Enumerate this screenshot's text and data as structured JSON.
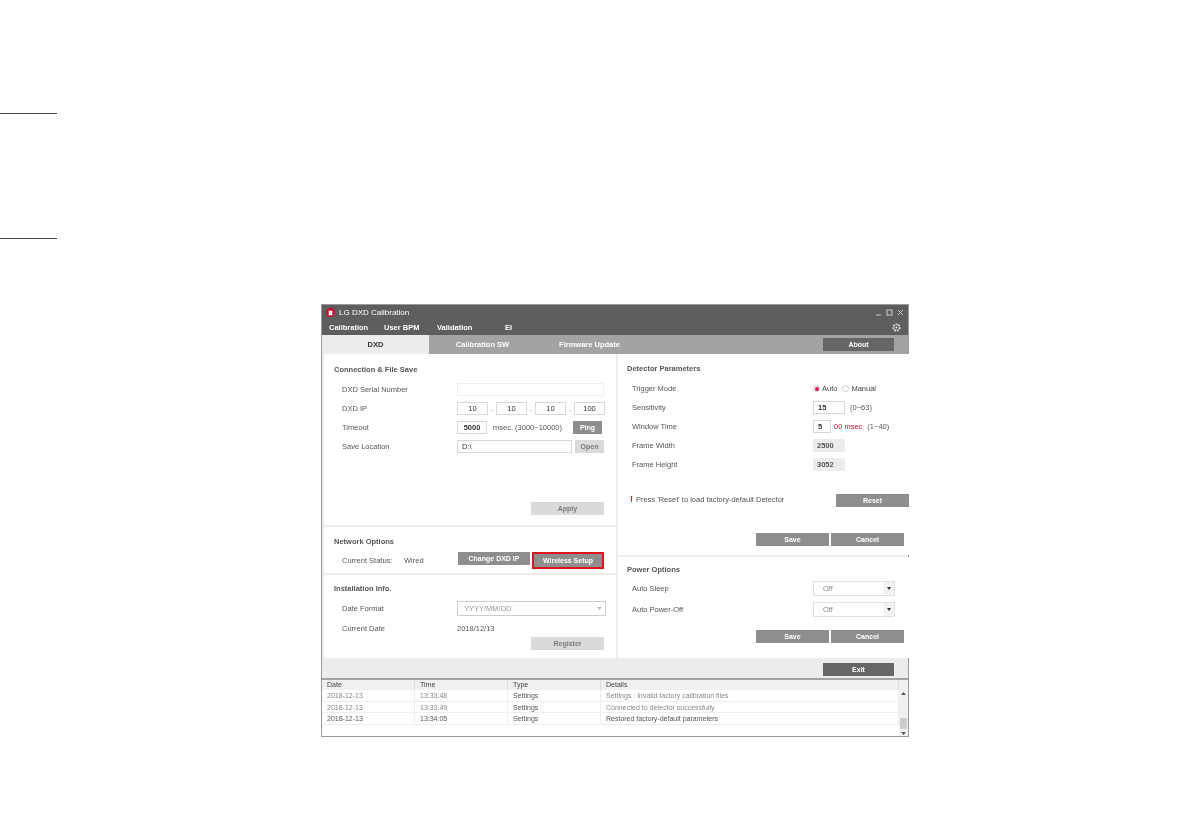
{
  "window": {
    "title": "LG DXD Calibration"
  },
  "menu": [
    "Calibration",
    "User BPM",
    "Validation",
    "EI"
  ],
  "tabs": [
    {
      "label": "DXD",
      "selected": true
    },
    {
      "label": "Calibration SW",
      "selected": false
    },
    {
      "label": "Firmware Update",
      "selected": false
    }
  ],
  "about_button": "About",
  "connection": {
    "title": "Connection & File Save",
    "serial_label": "DXD Serial Number",
    "ip_label": "DXD IP",
    "ip": [
      "10",
      "10",
      "10",
      "100"
    ],
    "ip_sep": ".",
    "timeout_label": "Timeout",
    "timeout": "5000",
    "timeout_hint": "msec. (3000~10000)",
    "ping": {
      "label": "Ping",
      "disabled": false
    },
    "save_label": "Save Location",
    "save_value": "D:\\",
    "open": {
      "label": "Open",
      "disabled": true
    },
    "apply": {
      "label": "Apply",
      "disabled": true
    }
  },
  "network": {
    "title": "Network Options",
    "status_label": "Current Status:",
    "status": "Wired",
    "buttons": [
      {
        "label": "Change DXD IP",
        "highlighted": false
      },
      {
        "label": "Wireless Setup",
        "highlighted": true
      }
    ]
  },
  "installation": {
    "title": "Installation Info.",
    "date_format_label": "Date Format",
    "date_format": "YYYY/MM/DD",
    "current_date_label": "Current Date",
    "current_date": "2018/12/13",
    "register": {
      "label": "Register",
      "disabled": true
    }
  },
  "detector": {
    "title": "Detector Parameters",
    "trigger_label": "Trigger Mode",
    "trigger_options": [
      {
        "label": "Auto",
        "selected": true
      },
      {
        "label": "Manual",
        "selected": false
      }
    ],
    "rows": [
      {
        "label": "Sensitivity",
        "value": "15",
        "unit": "",
        "hint": "(0~63)",
        "editable": true
      },
      {
        "label": "Window Time",
        "value": "5",
        "unit": "00 msec",
        "hint": "(1~40)",
        "editable": true
      },
      {
        "label": "Frame Width",
        "value": "2500",
        "unit": "",
        "hint": "",
        "editable": false
      },
      {
        "label": "Frame Height",
        "value": "3052",
        "unit": "",
        "hint": "",
        "editable": false
      }
    ],
    "warning_mark": "!",
    "warning": "Press 'Reset' to load factory-default Detector",
    "reset": "Reset",
    "save": "Save",
    "cancel": "Cancel"
  },
  "power": {
    "title": "Power Options",
    "rows": [
      {
        "label": "Auto Sleep",
        "value": "Off"
      },
      {
        "label": "Auto Power-Off",
        "value": "Off"
      }
    ],
    "save": "Save",
    "cancel": "Cancel"
  },
  "exit_button": "Exit",
  "log": {
    "columns": [
      "Date",
      "Time",
      "Type",
      "Details"
    ],
    "rows": [
      [
        "2018-12-13",
        "13:33:48",
        "Settings",
        "Settings : Invalid factory calibration files"
      ],
      [
        "2018-12-13",
        "13:33:49",
        "Settings",
        "Connected to detector successfully"
      ],
      [
        "2018-12-13",
        "13:34:05",
        "Settings",
        "Restored factory-default parameters"
      ]
    ]
  }
}
